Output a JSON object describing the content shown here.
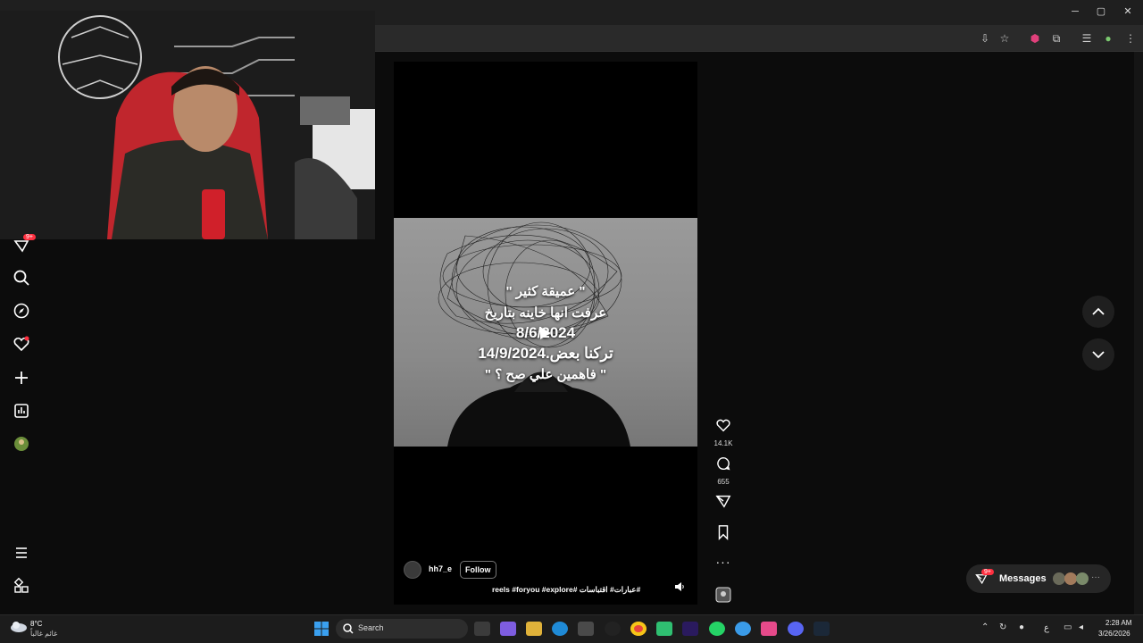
{
  "window": {
    "minimize": "─",
    "maximize": "▢",
    "close": "✕"
  },
  "toolbar": {
    "icons": [
      "install-icon",
      "star-icon",
      "shield-icon",
      "puzzle-icon",
      "tabs-icon",
      "profile-icon",
      "menu-icon"
    ]
  },
  "sidebar": {
    "items": [
      "inbox-icon",
      "search-icon",
      "explore-icon",
      "notifications-icon",
      "create-icon",
      "dashboard-icon",
      "profile-avatar",
      "more-icon",
      "meta-icon"
    ],
    "badge": "9+"
  },
  "post": {
    "caption_lines": [
      "\" عميقة كثير \"",
      "عرفت انها خاينه بتاريخ",
      "8/6/2024",
      "تركنا بعض.14/9/2024",
      "\" فاهمين علي صح ؟ \""
    ],
    "username": "hh7_e",
    "follow_label": "Follow",
    "hashtags": "reels #foryou #explore# عبارات# اقتباسات#"
  },
  "actions": {
    "likes": "14.1K",
    "comments": "655"
  },
  "messages": {
    "label": "Messages",
    "badge": "9+"
  },
  "taskbar": {
    "weather_temp": "8°C",
    "weather_desc": "غائم غالباً",
    "search_label": "Search",
    "time": "2:28 AM",
    "date": "3/26/2026",
    "lang": "ع"
  },
  "colors": {
    "bg": "#0c0c0c",
    "badge": "#ff3040",
    "accent": "#0095f6"
  }
}
